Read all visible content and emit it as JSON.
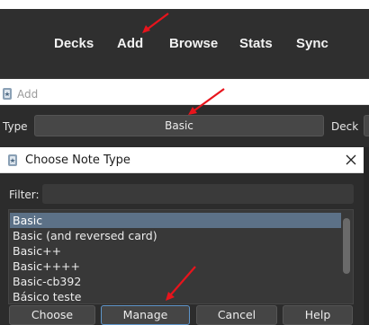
{
  "navbar": {
    "links": [
      "Decks",
      "Add",
      "Browse",
      "Stats",
      "Sync"
    ]
  },
  "add_window": {
    "title": "Add",
    "icon": "anki-app-icon",
    "type_label": "Type",
    "type_value": "Basic",
    "deck_label": "Deck"
  },
  "dialog": {
    "title": "Choose Note Type",
    "icon": "anki-app-icon",
    "close_icon": "close-icon",
    "filter_label": "Filter:",
    "filter_value": "",
    "list_items": [
      "Basic",
      "Basic (and reversed card)",
      "Basic++",
      "Basic++++",
      "Basic-cb392",
      "Básico teste"
    ],
    "selected_item": "Basic",
    "buttons": {
      "choose": "Choose",
      "manage": "Manage",
      "cancel": "Cancel",
      "help": "Help"
    }
  },
  "annotation": {
    "arrow_color": "#e8141c"
  }
}
